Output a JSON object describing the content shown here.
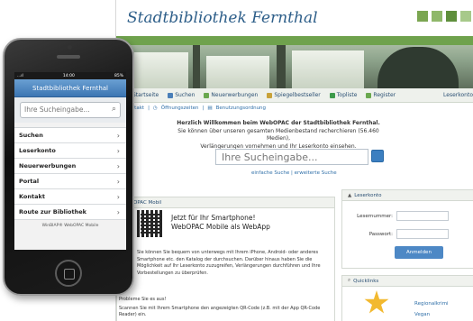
{
  "site": {
    "title": "Stadtbibliothek Fernthal",
    "header_colors": [
      "#7ba651",
      "#8fb86a",
      "#5f8f3c",
      "#a7c98a"
    ]
  },
  "navbar": {
    "items": [
      {
        "label": "Startseite",
        "icon": "home-icon",
        "color": "#6a8fb5"
      },
      {
        "label": "Suchen",
        "icon": "search-icon",
        "color": "#4a7fb8"
      },
      {
        "label": "Neuerwerbungen",
        "icon": "new-items-icon",
        "color": "#6aa84f"
      },
      {
        "label": "Spiegelbestseller",
        "icon": "chart-icon",
        "color": "#c8a23a"
      },
      {
        "label": "Topliste",
        "icon": "star-icon",
        "color": "#3d9a4a"
      },
      {
        "label": "Register",
        "icon": "list-icon",
        "color": "#6aa84f"
      }
    ],
    "account_label": "Leserkonto"
  },
  "subnav": {
    "items": [
      "Kontakt",
      "Öffnungszeiten",
      "Benutzungsordnung"
    ]
  },
  "welcome": {
    "line1": "Herzlich Willkommen beim WebOPAC der Stadtbibliothek Fernthal.",
    "line2": "Sie können über unseren gesamten Medienbestand recherchieren (56.460 Medien),",
    "line3": "Verlängerungen vornehmen und Ihr Leserkonto einsehen."
  },
  "desktop_search": {
    "placeholder": "Ihre Sucheingabe...",
    "links": "einfache Suche | erweiterte Suche"
  },
  "mobile_panel": {
    "heading": "WebOPAC Mobil",
    "promo_line1": "Jetzt für Ihr Smartphone!",
    "promo_line2": "WebOPAC Mobile als WebApp",
    "body": "Sie können Sie bequem von unterwegs mit Ihrem iPhone, Android- oder anderes Smartphone etc. den Katalog der durchsuchen. Darüber hinaus haben Sie die Möglichkeit auf Ihr Leserkonto zuzugreifen, Verlängerungen durchführen und Ihre Vorbestellungen zu überprüfen.",
    "problem_heading": "Probleme Sie es aus!",
    "problem_body": "Scannen Sie mit Ihrem Smartphone den angezeigten QR-Code (z.B. mit der App QR-Code Reader) ein."
  },
  "account_panel": {
    "heading": "Leserkonto",
    "card_label": "Lesernummer:",
    "password_label": "Passwort:",
    "login_button": "Anmelden"
  },
  "quick_panel": {
    "heading": "Quicklinks",
    "links": [
      "Regionalkrimi",
      "Vegan"
    ]
  },
  "phone": {
    "status_left": "...ıl",
    "status_time": "14:00",
    "status_right": "85%",
    "title": "Stadtbibliothek Fernthal",
    "search_placeholder": "Ihre Sucheingabe...",
    "menu": [
      "Suchen",
      "Leserkonto",
      "Neuerwerbungen",
      "Portal",
      "Kontakt",
      "Route zur Bibliothek"
    ],
    "footer": "WinBIAP® WebOPAC Mobile"
  }
}
